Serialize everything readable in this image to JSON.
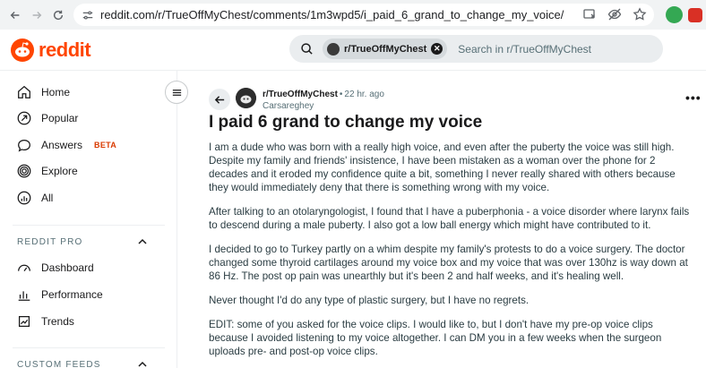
{
  "browser": {
    "url": "reddit.com/r/TrueOffMyChest/comments/1m3wpd5/i_paid_6_grand_to_change_my_voice/"
  },
  "header": {
    "logo_text": "reddit",
    "search_chip": "r/TrueOffMyChest",
    "search_placeholder": "Search in r/TrueOffMyChest"
  },
  "sidebar": {
    "items": [
      {
        "label": "Home",
        "icon": "home-icon"
      },
      {
        "label": "Popular",
        "icon": "popular-icon"
      },
      {
        "label": "Answers",
        "icon": "answers-icon",
        "badge": "BETA"
      },
      {
        "label": "Explore",
        "icon": "explore-icon"
      },
      {
        "label": "All",
        "icon": "all-icon"
      }
    ],
    "reddit_pro_heading": "REDDIT PRO",
    "pro_items": [
      {
        "label": "Dashboard",
        "icon": "dashboard-icon"
      },
      {
        "label": "Performance",
        "icon": "performance-icon"
      },
      {
        "label": "Trends",
        "icon": "trends-icon"
      }
    ],
    "custom_feeds_heading": "CUSTOM FEEDS"
  },
  "post": {
    "subreddit": "r/TrueOffMyChest",
    "separator": "•",
    "time": "22 hr. ago",
    "author": "Carsareghey",
    "more": "•••",
    "title": "I paid 6 grand to change my voice",
    "paragraphs": [
      "I am a dude who was born with a really high voice, and even after the puberty the voice was still high. Despite my family and friends' insistence, I have been mistaken as a woman over the phone for 2 decades and it eroded my confidence quite a bit, something I never really shared with others because they would immediately deny that there is something wrong with my voice.",
      "After talking to an otolaryngologist, I found that I have a puberphonia - a voice disorder where larynx fails to descend during a male puberty. I also got a low ball energy which might have contributed to it.",
      "I decided to go to Turkey partly on a whim despite my family's protests to do a voice surgery. The doctor changed some thyroid cartilages around my voice box and my voice that was over 130hz is way down at 86 Hz. The post op pain was unearthly but it's been 2 and half weeks, and it's healing well.",
      "Never thought I'd do any type of plastic surgery, but I have no regrets.",
      "EDIT: some of you asked for the voice clips. I would like to, but I don't have my pre-op voice clips because I avoided listening to my voice altogether. I can DM you in a few weeks when the surgeon uploads pre- and post-op voice clips."
    ]
  },
  "colors": {
    "accent": "#ff4500",
    "beta": "#d93a00"
  }
}
